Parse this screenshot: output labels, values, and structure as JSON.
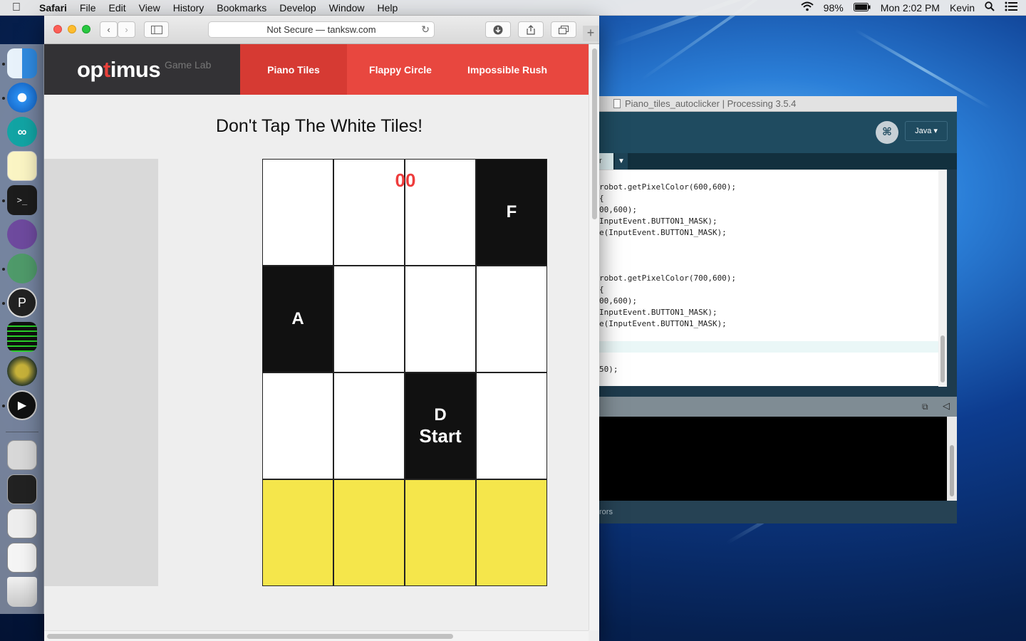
{
  "menubar": {
    "app": "Safari",
    "items": [
      "File",
      "Edit",
      "View",
      "History",
      "Bookmarks",
      "Develop",
      "Window",
      "Help"
    ],
    "battery": "98%",
    "clock": "Mon 2:02 PM",
    "user": "Kevin"
  },
  "safari": {
    "address": "Not Secure — tanksw.com"
  },
  "site": {
    "logo_pre": "op",
    "logo_t": "t",
    "logo_post": "imus",
    "logo_sub": "Game Lab",
    "tabs": [
      "Piano Tiles",
      "Flappy Circle",
      "Impossible Rush"
    ],
    "active_tab": "Piano Tiles",
    "title": "Don't Tap The White Tiles!"
  },
  "game": {
    "score": "00",
    "tile_F": "F",
    "tile_A": "A",
    "tile_D": "D",
    "tile_start": "Start",
    "colors": {
      "black": "#111111",
      "white": "#ffffff",
      "yellow": "#f5e64b",
      "score": "#ee3c3c"
    }
  },
  "processing": {
    "title": "Piano_tiles_autoclicker | Processing 3.5.4",
    "mode": "Java ▾",
    "tab_label": "r",
    "code": [
      "robot.getPixelColor(600,600);",
      "{",
      "00,600);",
      "InputEvent.BUTTON1_MASK);",
      "e(InputEvent.BUTTON1_MASK);",
      "",
      "",
      "",
      "robot.getPixelColor(700,600);",
      "{",
      "00,600);",
      "InputEvent.BUTTON1_MASK);",
      "e(InputEvent.BUTTON1_MASK);",
      "",
      "",
      "",
      "50);"
    ],
    "errors_label": "rors"
  }
}
